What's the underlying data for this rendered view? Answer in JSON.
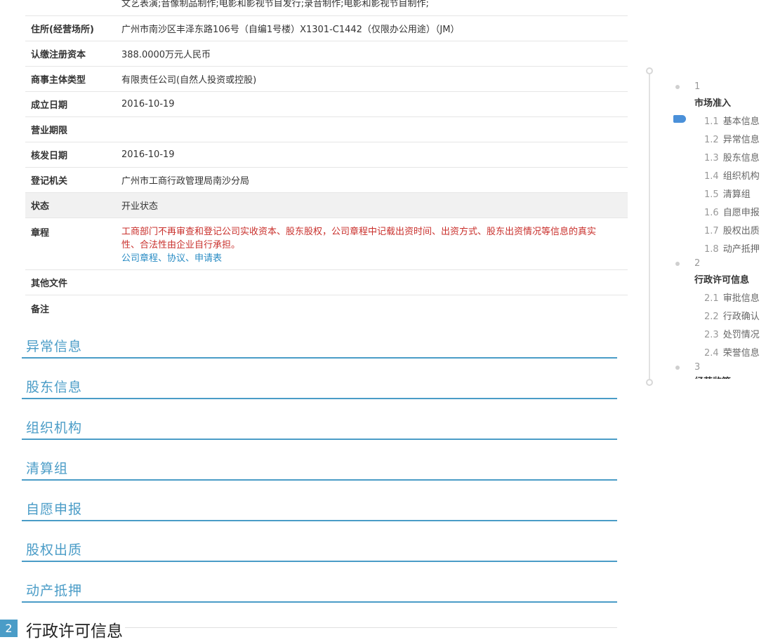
{
  "info": {
    "top_continuation": "文艺表演;音像制品制作;电影和影视节目发行;录音制作;电影和影视节目制作;",
    "rows": [
      {
        "key": "住所(经营场所)",
        "value": "广州市南沙区丰泽东路106号（自编1号楼）X1301-C1442（仅限办公用途）（JM）"
      },
      {
        "key": "认缴注册资本",
        "value": "388.0000万元人民币"
      },
      {
        "key": "商事主体类型",
        "value": "有限责任公司(自然人投资或控股)"
      },
      {
        "key": "成立日期",
        "value": "2016-10-19"
      },
      {
        "key": "营业期限",
        "value": ""
      },
      {
        "key": "核发日期",
        "value": "2016-10-19"
      },
      {
        "key": "登记机关",
        "value": "广州市工商行政管理局南沙分局"
      },
      {
        "key": "状态",
        "value": "开业状态"
      }
    ],
    "charter": {
      "key": "章程",
      "notice": "工商部门不再审查和登记公司实收资本、股东股权，公司章程中记载出资时间、出资方式、股东出资情况等信息的真实性、合法性由企业自行承担。",
      "links": "公司章程、协议、申请表"
    },
    "other_docs": {
      "key": "其他文件",
      "value": ""
    },
    "remarks": {
      "key": "备注",
      "value": ""
    }
  },
  "sections": [
    {
      "title": "异常信息"
    },
    {
      "title": "股东信息"
    },
    {
      "title": "组织机构"
    },
    {
      "title": "清算组"
    },
    {
      "title": "自愿申报"
    },
    {
      "title": "股权出质"
    },
    {
      "title": "动产抵押"
    }
  ],
  "major_section": {
    "number": "2",
    "title": "行政许可信息"
  },
  "nav": {
    "groups": [
      {
        "number": "1",
        "title": "市场准入",
        "items": [
          {
            "num": "1.1",
            "label": "基本信息"
          },
          {
            "num": "1.2",
            "label": "异常信息"
          },
          {
            "num": "1.3",
            "label": "股东信息"
          },
          {
            "num": "1.4",
            "label": "组织机构"
          },
          {
            "num": "1.5",
            "label": "清算组"
          },
          {
            "num": "1.6",
            "label": "自愿申报"
          },
          {
            "num": "1.7",
            "label": "股权出质"
          },
          {
            "num": "1.8",
            "label": "动产抵押"
          }
        ]
      },
      {
        "number": "2",
        "title": "行政许可信息",
        "items": [
          {
            "num": "2.1",
            "label": "审批信息"
          },
          {
            "num": "2.2",
            "label": "行政确认"
          },
          {
            "num": "2.3",
            "label": "处罚情况"
          },
          {
            "num": "2.4",
            "label": "荣誉信息"
          }
        ]
      },
      {
        "number": "3",
        "title": "经营监管"
      }
    ],
    "accent_color": "#4a90d9"
  }
}
